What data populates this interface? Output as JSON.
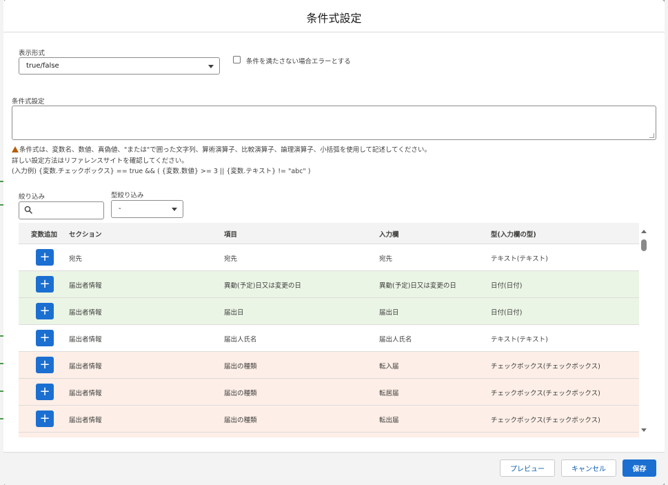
{
  "modal": {
    "title": "条件式設定"
  },
  "display_format": {
    "label": "表示形式",
    "value": "true/false"
  },
  "error_checkbox": {
    "label": "条件を満たさない場合エラーとする",
    "checked": false
  },
  "condition": {
    "label": "条件式設定",
    "value": "",
    "help": [
      "条件式は、変数名、数値、真偽値、\"または\"で囲った文字列、算術演算子、比較演算子、論理演算子、小括弧を使用して記述してください。",
      "詳しい設定方法はリファレンスサイトを確認してください。",
      "(入力例) {変数.チェックボックス} == true && ( {変数.数値} >= 3 || {変数.テキスト} != \"abc\" )"
    ]
  },
  "filter": {
    "label": "絞り込み",
    "value": ""
  },
  "type_filter": {
    "label": "型絞り込み",
    "value": "-"
  },
  "table": {
    "headers": [
      "変数追加",
      "セクション",
      "項目",
      "入力欄",
      "型(入力欄の型)"
    ],
    "add_label": "+",
    "rows": [
      {
        "section": "宛先",
        "item": "宛先",
        "input": "宛先",
        "type": "テキスト(テキスト)",
        "tone": "white"
      },
      {
        "section": "届出者情報",
        "item": "異動(予定)日又は変更の日",
        "input": "異動(予定)日又は変更の日",
        "type": "日付(日付)",
        "tone": "green"
      },
      {
        "section": "届出者情報",
        "item": "届出日",
        "input": "届出日",
        "type": "日付(日付)",
        "tone": "green"
      },
      {
        "section": "届出者情報",
        "item": "届出人氏名",
        "input": "届出人氏名",
        "type": "テキスト(テキスト)",
        "tone": "white"
      },
      {
        "section": "届出者情報",
        "item": "届出の種類",
        "input": "転入届",
        "type": "チェックボックス(チェックボックス)",
        "tone": "pink"
      },
      {
        "section": "届出者情報",
        "item": "届出の種類",
        "input": "転居届",
        "type": "チェックボックス(チェックボックス)",
        "tone": "pink"
      },
      {
        "section": "届出者情報",
        "item": "届出の種類",
        "input": "転出届",
        "type": "チェックボックス(チェックボックス)",
        "tone": "pink"
      },
      {
        "section": "",
        "item": "",
        "input": "",
        "type": "",
        "tone": "pink"
      }
    ]
  },
  "footer": {
    "preview_label": "プレビュー",
    "cancel_label": "キャンセル",
    "save_label": "保存"
  },
  "colors": {
    "brand": "#1b6fd1",
    "row_green": "#ebf5e6",
    "row_pink": "#fdeee7",
    "warning": "#b75d00"
  }
}
